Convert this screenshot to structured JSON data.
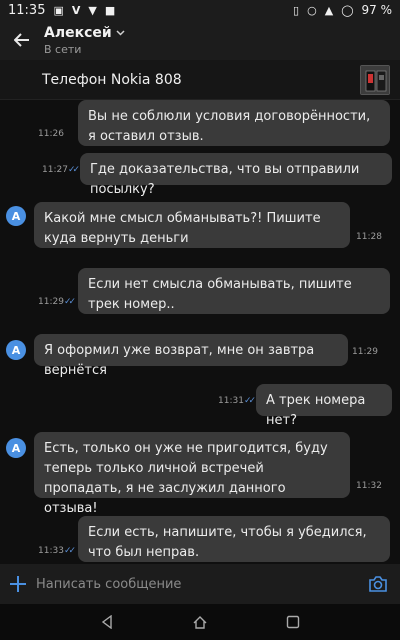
{
  "statusbar": {
    "time": "11:35",
    "battery": "97 %"
  },
  "header": {
    "contact_name": "Алексей",
    "presence": "В сети"
  },
  "listing": {
    "title": "Телефон Nokia 808"
  },
  "messages": [
    {
      "side": "out",
      "text": "Вы не соблюли условия договорённости, я оставил отзыв.",
      "time": "11:26"
    },
    {
      "side": "out",
      "text": "Где доказательства, что вы отправили посылку?",
      "time": "11:27"
    },
    {
      "side": "in",
      "avatar": "А",
      "text": "Какой мне смысл обманывать?! Пишите куда вернуть деньги",
      "time": "11:28"
    },
    {
      "side": "out",
      "text": "Если нет смысла обманывать, пишите трек номер..",
      "time": "11:29"
    },
    {
      "side": "in",
      "avatar": "А",
      "text": "Я оформил уже возврат, мне он завтра вернётся",
      "time": "11:29"
    },
    {
      "side": "out",
      "text": "А трек номера нет?",
      "time": "11:31"
    },
    {
      "side": "in",
      "avatar": "А",
      "text": "Есть, только он уже не пригодится, буду теперь только личной встречей пропадать, я не заслужил данного отзыва!",
      "time": "11:32"
    },
    {
      "side": "out",
      "text": "Если есть, напишите, чтобы я убедился, что был неправ.",
      "time": "11:33"
    }
  ],
  "composer": {
    "placeholder": "Написать сообщение"
  },
  "colors": {
    "accent": "#4a90e2",
    "bubble": "#3a3a3a",
    "background": "#0f0f0f"
  }
}
